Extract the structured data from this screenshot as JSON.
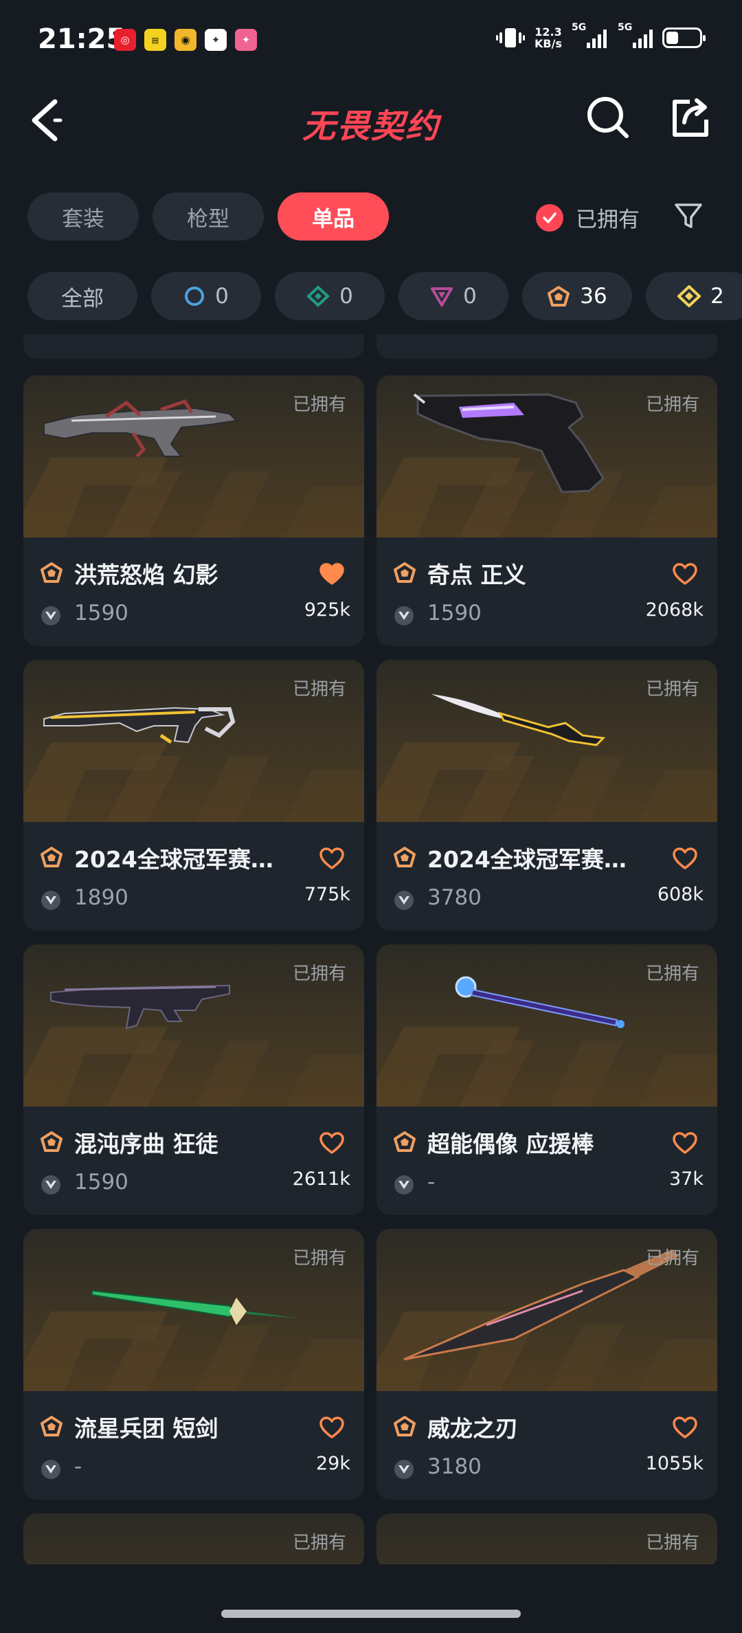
{
  "status_bar": {
    "time": "21:25",
    "net_speed_value": "12.3",
    "net_speed_unit": "KB/s",
    "sim1": "5G",
    "sim2": "5G",
    "app_icon_colors": [
      "#e8202e",
      "#f4d21f",
      "#f2b62a",
      "#ffffff",
      "#f06292"
    ]
  },
  "header": {
    "title": "无畏契约"
  },
  "tabs": [
    {
      "label": "套装",
      "active": false
    },
    {
      "label": "枪型",
      "active": false
    },
    {
      "label": "单品",
      "active": true
    }
  ],
  "owned_toggle": {
    "label": "已拥有",
    "checked": true
  },
  "rarity_filters": [
    {
      "label": "全部",
      "icon": "none"
    },
    {
      "icon": "select-tier-icon",
      "count": "0"
    },
    {
      "icon": "deluxe-tier-icon",
      "count": "0"
    },
    {
      "icon": "premium-tier-icon",
      "count": "0"
    },
    {
      "icon": "exclusive-tier-icon",
      "count": "36"
    },
    {
      "icon": "ultra-tier-icon",
      "count": "2"
    }
  ],
  "items": [
    {
      "name": "洪荒怒焰 幻影",
      "price": "1590",
      "likes": "925k",
      "owned_tag": "已拥有",
      "liked": true,
      "weapon_icon": "rifle-phantom-icon"
    },
    {
      "name": "奇点 正义",
      "price": "1590",
      "likes": "2068k",
      "owned_tag": "已拥有",
      "liked": false,
      "weapon_icon": "revolver-sheriff-icon"
    },
    {
      "name": "2024全球冠军赛…",
      "price": "1890",
      "likes": "775k",
      "owned_tag": "已拥有",
      "liked": false,
      "weapon_icon": "rifle-champions-icon"
    },
    {
      "name": "2024全球冠军赛…",
      "price": "3780",
      "likes": "608k",
      "owned_tag": "已拥有",
      "liked": false,
      "weapon_icon": "knife-champions-icon"
    },
    {
      "name": "混沌序曲 狂徒",
      "price": "1590",
      "likes": "2611k",
      "owned_tag": "已拥有",
      "liked": false,
      "weapon_icon": "rifle-vandal-icon"
    },
    {
      "name": "超能偶像 应援棒",
      "price": "-",
      "likes": "37k",
      "owned_tag": "已拥有",
      "liked": false,
      "weapon_icon": "lightstick-icon"
    },
    {
      "name": "流星兵团 短剑",
      "price": "-",
      "likes": "29k",
      "owned_tag": "已拥有",
      "liked": false,
      "weapon_icon": "dagger-icon"
    },
    {
      "name": "威龙之刃",
      "price": "3180",
      "likes": "1055k",
      "owned_tag": "已拥有",
      "liked": false,
      "weapon_icon": "blade-icon"
    },
    {
      "owned_tag": "已拥有"
    },
    {
      "owned_tag": "已拥有"
    }
  ],
  "colors": {
    "accent": "#ff4655",
    "tier_exclusive": "#f0a061",
    "heart": "#ff8a4c"
  }
}
